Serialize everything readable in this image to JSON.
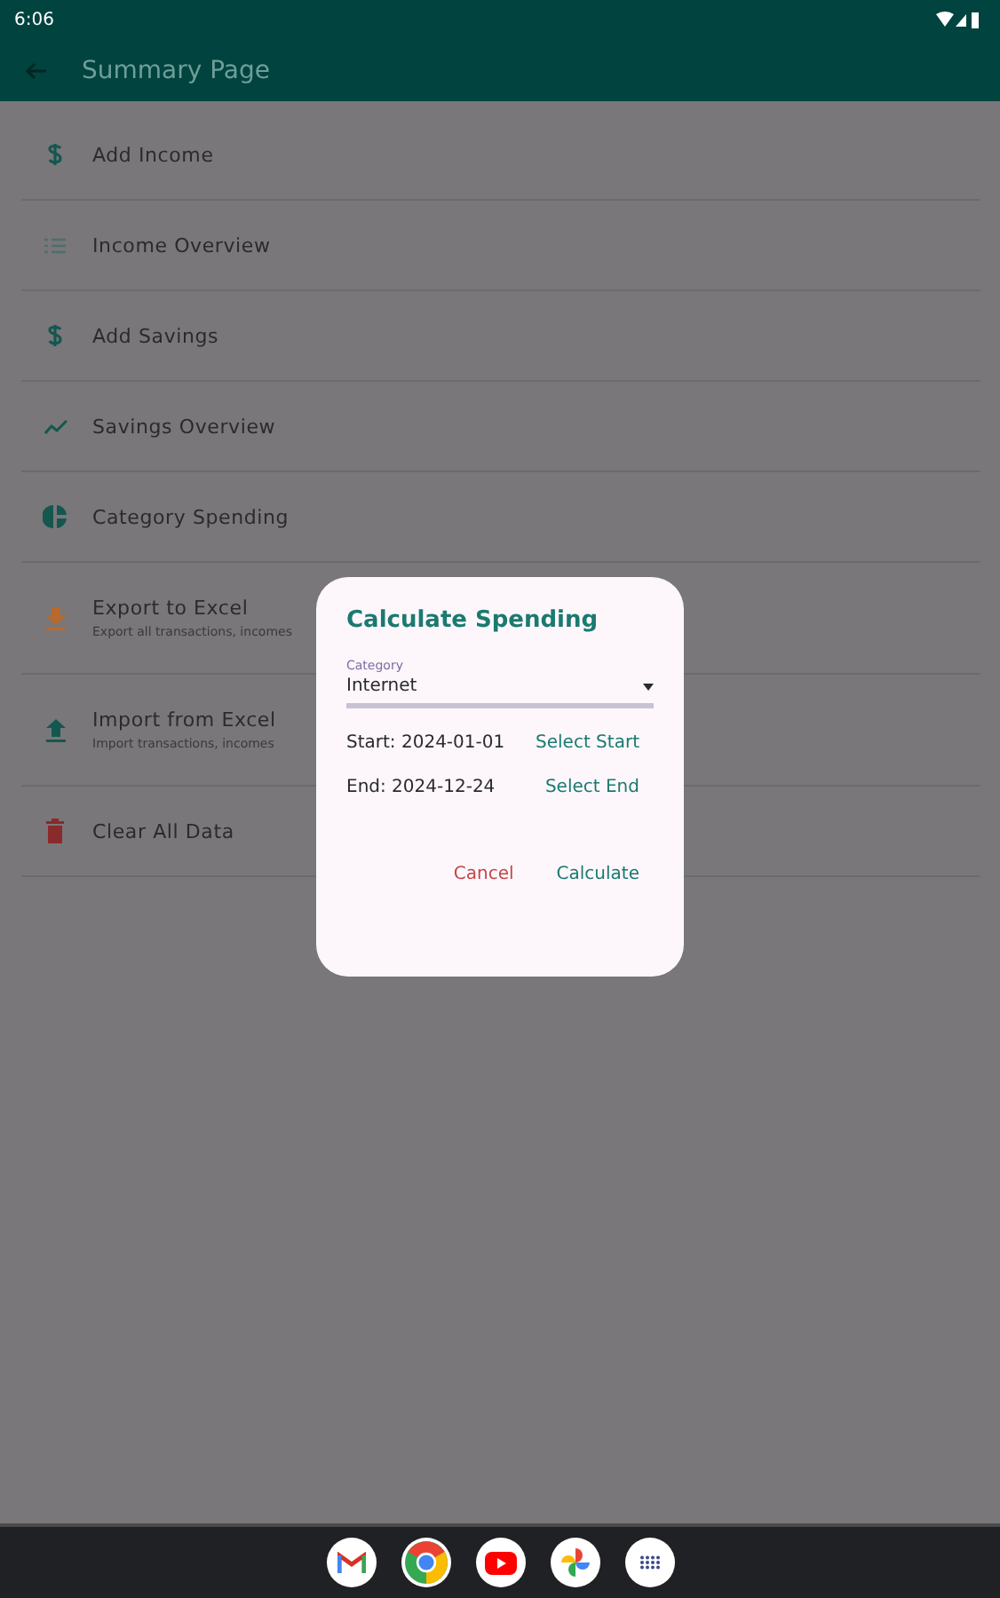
{
  "status_bar": {
    "time": "6:06"
  },
  "app_bar": {
    "title": "Summary Page"
  },
  "menu_items": [
    {
      "kind": "dollar",
      "title": "Add Income"
    },
    {
      "kind": "list",
      "title": "Income Overview"
    },
    {
      "kind": "dollar",
      "title": "Add Savings"
    },
    {
      "kind": "trend",
      "title": "Savings Overview"
    },
    {
      "kind": "pie",
      "title": "Category Spending"
    },
    {
      "kind": "download",
      "title": "Export to Excel",
      "subtitle": "Export all transactions, incomes"
    },
    {
      "kind": "upload",
      "title": "Import from Excel",
      "subtitle": "Import transactions, incomes"
    },
    {
      "kind": "trash",
      "title": "Clear All Data"
    }
  ],
  "dialog": {
    "title": "Calculate Spending",
    "category_label": "Category",
    "category_value": "Internet",
    "start": "Start: 2024-01-01",
    "select_start": "Select Start",
    "end": "End: 2024-12-24",
    "select_end": "Select End",
    "cancel": "Cancel",
    "confirm": "Calculate"
  },
  "dock": [
    {
      "kind": "mail"
    },
    {
      "kind": "browser"
    },
    {
      "kind": "video"
    },
    {
      "kind": "photos"
    },
    {
      "kind": "apps"
    }
  ]
}
